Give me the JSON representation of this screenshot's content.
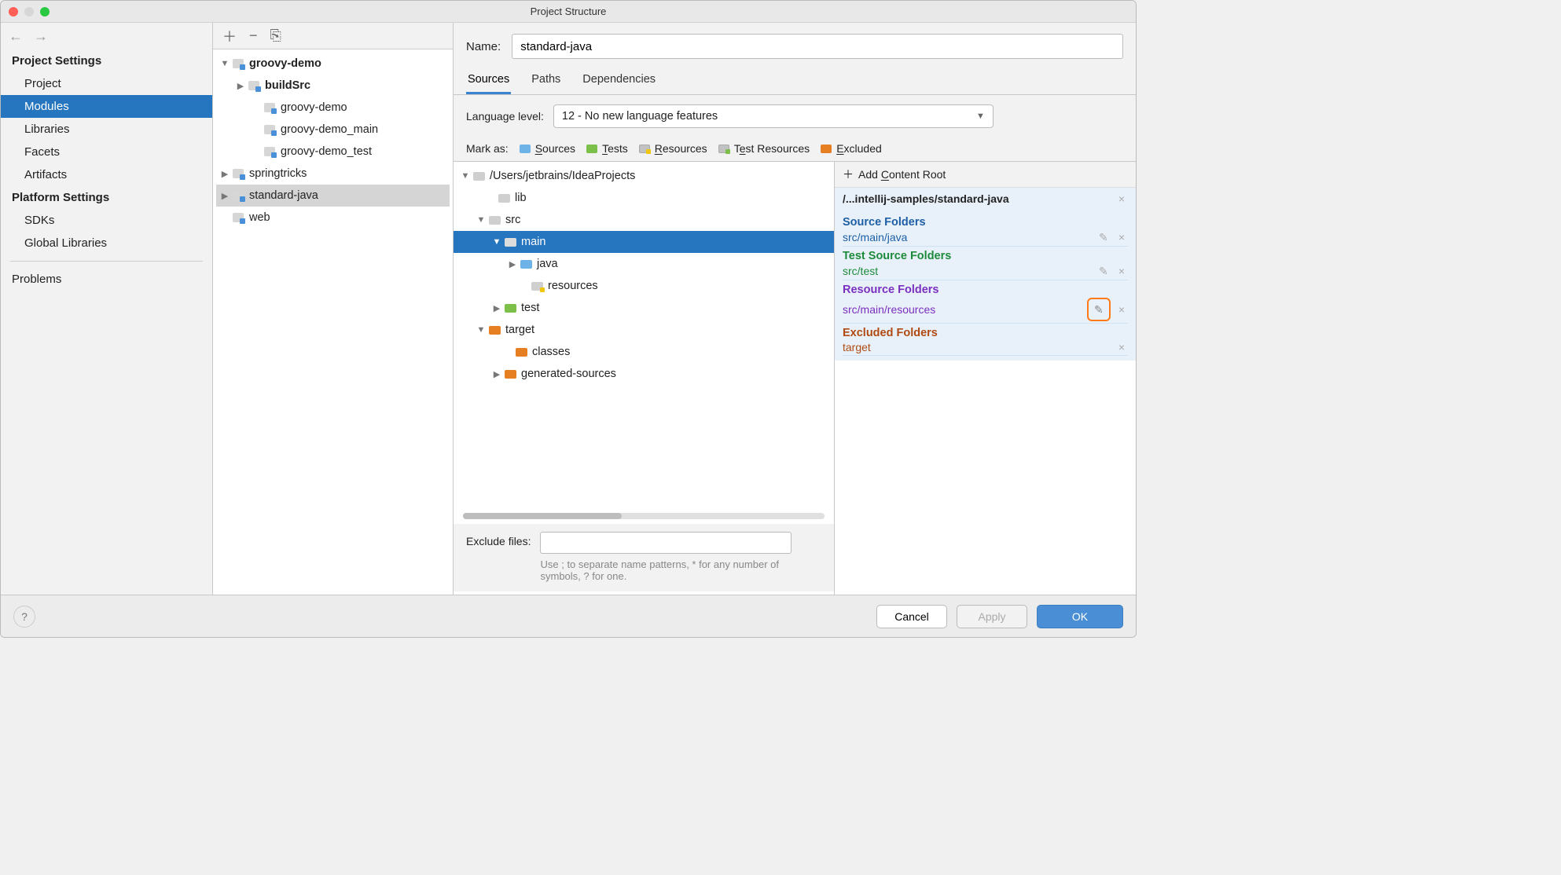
{
  "title": "Project Structure",
  "left": {
    "section1": "Project Settings",
    "items1": [
      "Project",
      "Modules",
      "Libraries",
      "Facets",
      "Artifacts"
    ],
    "section2": "Platform Settings",
    "items2": [
      "SDKs",
      "Global Libraries"
    ],
    "extra": "Problems"
  },
  "modules": {
    "root": "groovy-demo",
    "buildSrc": "buildSrc",
    "sub1": "groovy-demo",
    "sub2": "groovy-demo_main",
    "sub3": "groovy-demo_test",
    "m2": "springtricks",
    "m3": "standard-java",
    "m4": "web"
  },
  "name": {
    "label": "Name:",
    "value": "standard-java"
  },
  "tabs": [
    "Sources",
    "Paths",
    "Dependencies"
  ],
  "lang": {
    "label": "Language level:",
    "value": "12 - No new language features"
  },
  "mark": {
    "label": "Mark as:",
    "sources": "Sources",
    "tests": "Tests",
    "resources": "Resources",
    "tresources": "Test Resources",
    "excluded": "Excluded"
  },
  "srctree": {
    "root": "/Users/jetbrains/IdeaProjects",
    "lib": "lib",
    "src": "src",
    "main": "main",
    "java": "java",
    "resources": "resources",
    "test": "test",
    "target": "target",
    "classes": "classes",
    "gensrc": "generated-sources"
  },
  "roots": {
    "add": "Add Content Root",
    "path": "/...intellij-samples/standard-java",
    "srcFoldersTitle": "Source Folders",
    "srcFolder": "src/main/java",
    "testFoldersTitle": "Test Source Folders",
    "testFolder": "src/test",
    "resFoldersTitle": "Resource Folders",
    "resFolder": "src/main/resources",
    "excFoldersTitle": "Excluded Folders",
    "excFolder": "target"
  },
  "exclude": {
    "label": "Exclude files:",
    "help": "Use ; to separate name patterns, * for any number of symbols, ? for one."
  },
  "buttons": {
    "cancel": "Cancel",
    "apply": "Apply",
    "ok": "OK"
  }
}
